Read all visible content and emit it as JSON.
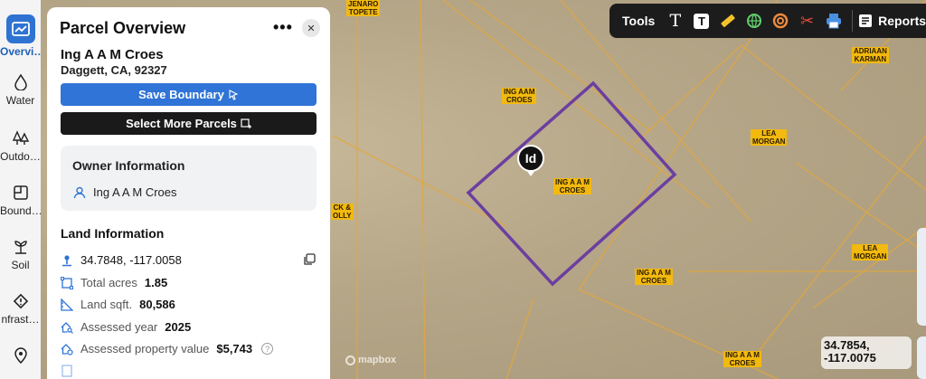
{
  "map": {
    "parcel_labels": [
      {
        "id": "jenaro",
        "lines": [
          "JENARO",
          "TOPETE"
        ]
      },
      {
        "id": "ingaam-top",
        "lines": [
          "ING AAM",
          "CROES"
        ]
      },
      {
        "id": "ingaam-center",
        "lines": [
          "ING A A M",
          "CROES"
        ]
      },
      {
        "id": "ingaam-lower",
        "lines": [
          "ING A A M",
          "CROES"
        ]
      },
      {
        "id": "ingaam-bottom",
        "lines": [
          "ING A A M",
          "CROES"
        ]
      },
      {
        "id": "adriaan",
        "lines": [
          "ADRIAAN",
          "KARMAN"
        ]
      },
      {
        "id": "lea-1",
        "lines": [
          "LEA",
          "MORGAN"
        ]
      },
      {
        "id": "lea-2",
        "lines": [
          "LEA",
          "MORGAN"
        ]
      },
      {
        "id": "ck-olly",
        "lines": [
          "CK &",
          "OLLY"
        ]
      }
    ],
    "pin_text": "Id",
    "attribution": "mapbox",
    "coordinate_readout": [
      "34.7854,",
      "-117.0075"
    ],
    "parcel_highlight_color": "#6b3fa0",
    "boundary_color": "#e2a73b"
  },
  "toolbar": {
    "label": "Tools",
    "tools": [
      {
        "name": "text-tool-icon",
        "glyph": "T"
      },
      {
        "name": "text-box-tool-icon",
        "glyph": "T"
      },
      {
        "name": "ruler-tool-icon",
        "glyph": "📏"
      },
      {
        "name": "globe-tool-icon",
        "glyph": "🌐"
      },
      {
        "name": "circle-tool-icon",
        "glyph": "◎"
      },
      {
        "name": "scissors-tool-icon",
        "glyph": "✂"
      },
      {
        "name": "print-tool-icon",
        "glyph": "🖶"
      }
    ],
    "reports_label": "Reports"
  },
  "nav": {
    "items": [
      {
        "id": "overview",
        "label": "Overvi…",
        "active": true
      },
      {
        "id": "water",
        "label": "Water"
      },
      {
        "id": "outdoor",
        "label": "Outdo…"
      },
      {
        "id": "boundaries",
        "label": "Bound…"
      },
      {
        "id": "soil",
        "label": "Soil"
      },
      {
        "id": "infrastructure",
        "label": "nfrast…"
      },
      {
        "id": "location",
        "label": ""
      }
    ]
  },
  "panel": {
    "title": "Parcel Overview",
    "owner": "Ing A A M Croes",
    "address": "Daggett, CA, 92327",
    "save_label": "Save Boundary",
    "select_label": "Select More Parcels",
    "owner_info": {
      "title": "Owner Information",
      "name": "Ing A A M Croes"
    },
    "land_info": {
      "title": "Land Information",
      "coordinates": "34.7848, -117.0058",
      "acres_label": "Total acres",
      "acres_value": "1.85",
      "sqft_label": "Land sqft.",
      "sqft_value": "80,586",
      "year_label": "Assessed year",
      "year_value": "2025",
      "value_label": "Assessed property value",
      "value_value": "$5,743"
    }
  },
  "colors": {
    "accent": "#2f74d6",
    "dark_button": "#1a1a1a",
    "label_yellow": "#f2b90f"
  }
}
